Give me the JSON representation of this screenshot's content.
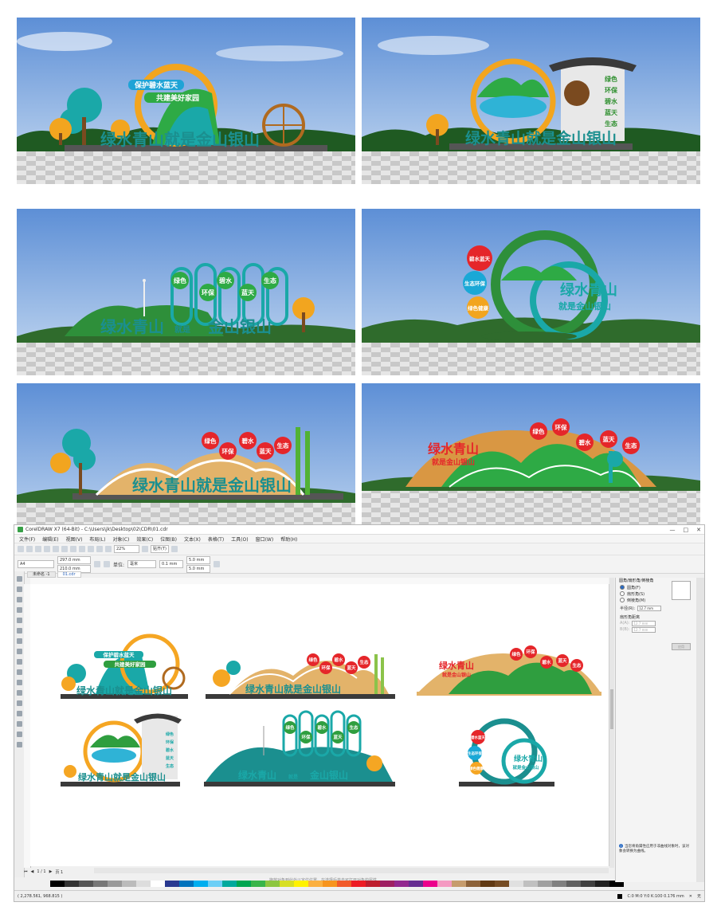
{
  "renders": [
    {
      "id": "r1",
      "slogan1": "保护碧水蓝天",
      "slogan2": "共建美好家园",
      "main": "绿水青山就是金山银山"
    },
    {
      "id": "r2",
      "side": [
        "绿色",
        "环保",
        "碧水",
        "蓝天",
        "生态"
      ],
      "main": "绿水青山就是金山银山"
    },
    {
      "id": "r3",
      "circles": [
        "绿色",
        "环保",
        "碧水",
        "蓝天",
        "生态"
      ],
      "main_left": "绿水青山",
      "main_mid": "就是",
      "main_right": "金山银山"
    },
    {
      "id": "r4",
      "bubbles": [
        "碧水蓝天",
        "生态环保",
        "绿色健康"
      ],
      "line1": "绿水青山",
      "line2": "就是金山银山"
    },
    {
      "id": "r5",
      "circles": [
        "绿色",
        "环保",
        "碧水",
        "蓝天",
        "生态"
      ],
      "main": "绿水青山就是金山银山"
    },
    {
      "id": "r6",
      "title": "绿水青山",
      "subtitle": "就是金山银山",
      "circles": [
        "绿色",
        "环保",
        "碧水",
        "蓝天",
        "生态"
      ]
    }
  ],
  "app": {
    "title": "CorelDRAW X7 (64-Bit) - C:\\Users\\jk\\Desktop\\02\\CDR\\01.cdr",
    "window_buttons": [
      "—",
      "□",
      "✕"
    ],
    "menu": [
      "文件(F)",
      "编辑(E)",
      "视图(V)",
      "布局(L)",
      "对象(C)",
      "效果(C)",
      "位图(B)",
      "文本(X)",
      "表格(T)",
      "工具(O)",
      "窗口(W)",
      "帮助(H)"
    ],
    "zoom": "22%",
    "snap": "贴齐(T)",
    "page_size": "A4",
    "width": "297.0 mm",
    "height": "210.0 mm",
    "units_label": "单位:",
    "units": "毫米",
    "nudge": "0.1 mm",
    "dup_x": "5.0 mm",
    "dup_y": "5.0 mm",
    "tabs": [
      "未命名 -1",
      "01.cdr"
    ],
    "page_nav": "1 / 1",
    "page_tab": "页 1",
    "coords": "( 2,278.561, 968.815 )",
    "canvas_hint": "拖放对象到此处以定位位置。在选择后单击可打开对象的属性...",
    "fill_info": "C:0 M:0 Y:0 K:100  0.176 mm",
    "fill_none": "无"
  },
  "docker": {
    "header": "圆角/扇形角/倒棱角",
    "options": [
      "圆角(F)",
      "扇形角(S)",
      "倒棱角(M)"
    ],
    "radius_label": "半径(R):",
    "radius": "12.7 mm",
    "distance_label": "扇形角距离",
    "a_label": "A(A):",
    "a_value": "12.7 mm",
    "b_label": "B(B):",
    "b_value": "12.7 mm",
    "apply": "应用",
    "info": "当您将角属性应用于非曲线对象时，该对象会转换为曲线。"
  },
  "thumbs": [
    {
      "slogan1": "保护碧水蓝天",
      "slogan2": "共建美好家园",
      "main": "绿水青山就是金山银山"
    },
    {
      "circles": [
        "绿色",
        "环保",
        "碧水",
        "蓝天",
        "生态"
      ],
      "main": "绿水青山就是金山银山"
    },
    {
      "title": "绿水青山",
      "subtitle": "就是金山银山",
      "circles": [
        "绿色",
        "环保",
        "碧水",
        "蓝天",
        "生态"
      ]
    },
    {
      "side": [
        "绿色",
        "环保",
        "碧水",
        "蓝天",
        "生态"
      ],
      "main": "绿水青山就是金山银山"
    },
    {
      "circles": [
        "绿色",
        "环保",
        "碧水",
        "蓝天",
        "生态"
      ],
      "main_left": "绿水青山",
      "main_mid": "就是",
      "main_right": "金山银山"
    },
    {
      "bubbles": [
        "碧水蓝天",
        "生态环保",
        "绿色健康"
      ],
      "line1": "绿水青山",
      "line2": "就是金山银山"
    }
  ],
  "colors": {
    "teal": "#1aa8a8",
    "green": "#2f9e3f",
    "orange": "#f5a623",
    "red": "#e5262a",
    "yellow": "#f7c41b",
    "dark": "#3a3a3a"
  }
}
